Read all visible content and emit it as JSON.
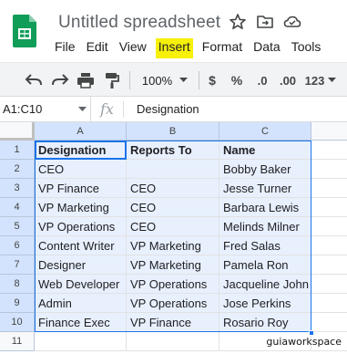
{
  "app": {
    "title": "Untitled spreadsheet"
  },
  "menu": [
    "File",
    "Edit",
    "View",
    "Insert",
    "Format",
    "Data",
    "Tools"
  ],
  "menu_highlight_color": "#f7f00a",
  "toolbar": {
    "zoom": "100%",
    "currency": "$",
    "percent": "%",
    "decrease_decimal": ".0",
    "increase_decimal": ".00",
    "more_formats": "123"
  },
  "formula_bar": {
    "name_box": "A1:C10",
    "fx": "fx",
    "content": "Designation"
  },
  "grid": {
    "columns": [
      "A",
      "B",
      "C"
    ],
    "rows": [
      "1",
      "2",
      "3",
      "4",
      "5",
      "6",
      "7",
      "8",
      "9",
      "10",
      "11"
    ],
    "cells": [
      [
        "Designation",
        "Reports To",
        "Name"
      ],
      [
        "CEO",
        "",
        "Bobby Baker"
      ],
      [
        "VP Finance",
        "CEO",
        "Jesse Turner"
      ],
      [
        "VP Marketing",
        "CEO",
        "Barbara Lewis"
      ],
      [
        "VP Operations",
        "CEO",
        "Melinds Milner"
      ],
      [
        "Content Writer",
        "VP Marketing",
        "Fred Salas"
      ],
      [
        "Designer",
        "VP Marketing",
        "Pamela Ron"
      ],
      [
        "Web Developer",
        "VP Operations",
        "Jacqueline John"
      ],
      [
        "Admin",
        "VP Operations",
        "Jose Perkins"
      ],
      [
        "Finance Exec",
        "VP Finance",
        "Rosario Roy"
      ]
    ]
  },
  "colors": {
    "selection": "#1a73e8",
    "selected_fill": "#e8f0fe",
    "logo_green": "#0f9d58"
  },
  "watermark": "guiaworkspace"
}
